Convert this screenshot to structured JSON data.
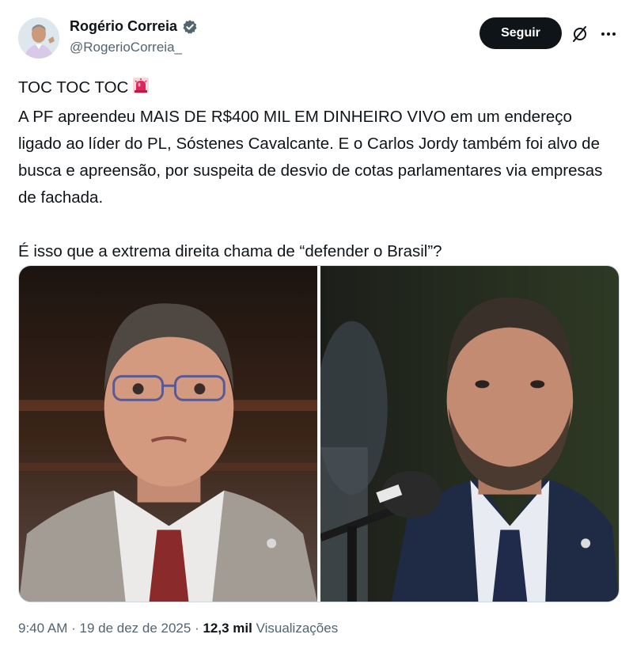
{
  "author": {
    "display_name": "Rogério Correia",
    "handle": "@RogerioCorreia_",
    "verified": true,
    "verified_color": "#536471"
  },
  "header": {
    "follow_label": "Seguir",
    "grok_icon": "grok-slash-icon",
    "more_icon": "more-dots-icon"
  },
  "tweet": {
    "line1": "TOC TOC TOC",
    "line1_emoji": "police-siren-icon",
    "paragraph": "A PF apreendeu MAIS DE R$400 MIL EM DINHEIRO VIVO em um endereço ligado ao líder do PL, Sóstenes Cavalcante. E o Carlos Jordy também foi alvo de busca e apreensão, por suspeita de desvio de cotas parlamentares via empresas de fachada.",
    "question": "É isso que a extrema direita chama de “defender o Brasil”?"
  },
  "media": {
    "photos": [
      "photo-left-man-glasses",
      "photo-right-man-beard-microphone"
    ]
  },
  "footer": {
    "time": "9:40 AM",
    "separator": " · ",
    "date": "19 de dez de 2025",
    "views_count": "12,3 mil",
    "views_label": "Visualizações"
  },
  "colors": {
    "text": "#0f1419",
    "secondary": "#536471",
    "button_bg": "#0f1419",
    "siren_red": "#e0245e"
  }
}
